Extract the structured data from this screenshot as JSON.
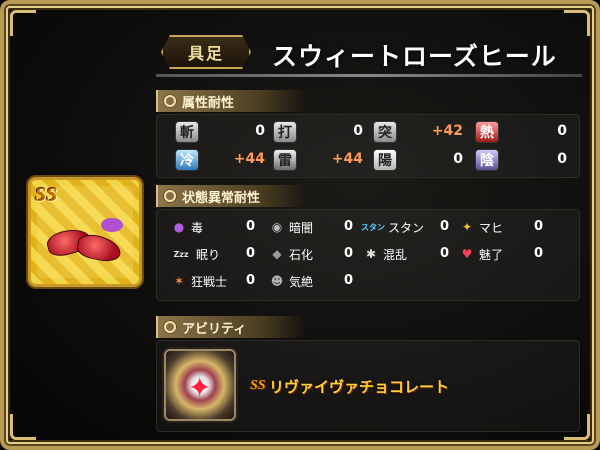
{
  "equipment": {
    "type_label": "具足",
    "name": "スウィートローズヒール",
    "icon_badge": "SS"
  },
  "elemental": {
    "header": "属性耐性",
    "rows": [
      [
        {
          "icon": "斬",
          "kind": "slash",
          "value": "0"
        },
        {
          "icon": "打",
          "kind": "blunt",
          "value": "0"
        },
        {
          "icon": "突",
          "kind": "pierce",
          "value": "+42"
        },
        {
          "icon": "熱",
          "kind": "fire",
          "value": "0"
        }
      ],
      [
        {
          "icon": "冷",
          "kind": "ice",
          "value": "+44"
        },
        {
          "icon": "雷",
          "kind": "thunder",
          "value": "+44"
        },
        {
          "icon": "陽",
          "kind": "light",
          "value": "0"
        },
        {
          "icon": "陰",
          "kind": "dark",
          "value": "0"
        }
      ]
    ]
  },
  "status": {
    "header": "状態異常耐性",
    "rows": [
      [
        {
          "icon": "●",
          "icon_name": "poison-icon",
          "color": "#b05ae0",
          "label": "毒",
          "value": "0"
        },
        {
          "icon": "◉",
          "icon_name": "darkness-icon",
          "color": "#bbbbbb",
          "label": "暗闇",
          "value": "0"
        },
        {
          "icon": "スタン",
          "icon_name": "stun-icon",
          "color": "#5ad0ff",
          "label": "スタン",
          "value": "0"
        },
        {
          "icon": "✦",
          "icon_name": "paralysis-icon",
          "color": "#f0c030",
          "label": "マヒ",
          "value": "0"
        }
      ],
      [
        {
          "icon": "Zzz",
          "icon_name": "sleep-icon",
          "color": "#dddddd",
          "label": "眠り",
          "value": "0"
        },
        {
          "icon": "◆",
          "icon_name": "petrify-icon",
          "color": "#9a9a9a",
          "label": "石化",
          "value": "0"
        },
        {
          "icon": "✱",
          "icon_name": "confusion-icon",
          "color": "#e0e0e0",
          "label": "混乱",
          "value": "0"
        },
        {
          "icon": "♥",
          "icon_name": "charm-icon",
          "color": "#ff4060",
          "label": "魅了",
          "value": "0"
        }
      ],
      [
        {
          "icon": "✶",
          "icon_name": "berserk-icon",
          "color": "#ff8a3a",
          "label": "狂戦士",
          "value": "0"
        },
        {
          "icon": "☻",
          "icon_name": "faint-icon",
          "color": "#b0b0b0",
          "label": "気絶",
          "value": "0"
        }
      ]
    ]
  },
  "ability": {
    "header": "アビリティ",
    "badge": "SS",
    "name": "リヴァイヴァチョコレート"
  }
}
